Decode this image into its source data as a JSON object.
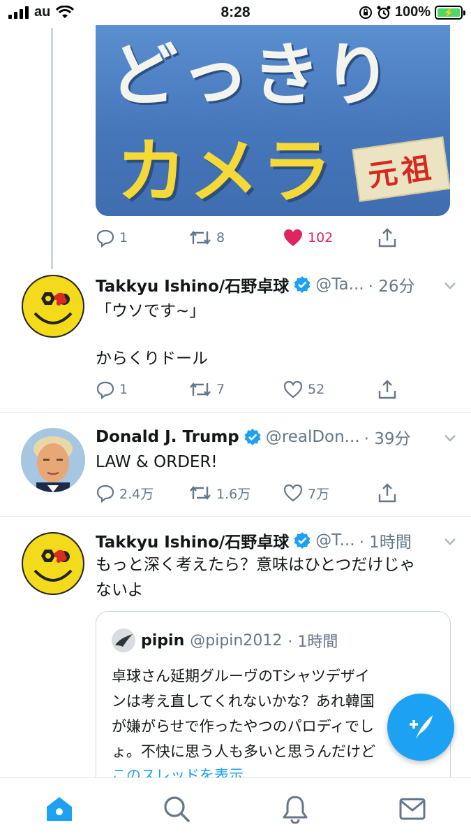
{
  "status_bar": {
    "carrier": "au",
    "time": "8:28",
    "battery": "100%"
  },
  "tweet0": {
    "media_text_top": "どっきり",
    "media_text_main": "カメラ",
    "media_text_badge": "元祖",
    "replies": "1",
    "retweets": "8",
    "likes": "102"
  },
  "tweet1": {
    "name": "Takkyu Ishino/石野卓球",
    "handle": "@Ta...",
    "time": "· 26分",
    "line1": "「ウソです~」",
    "line2": "からくりドール",
    "replies": "1",
    "retweets": "7",
    "likes": "52"
  },
  "tweet2": {
    "name": "Donald J. Trump",
    "handle": "@realDon...",
    "time": "· 39分",
    "text": "LAW & ORDER!",
    "replies": "2.4万",
    "retweets": "1.6万",
    "likes": "7万"
  },
  "tweet3": {
    "name": "Takkyu Ishino/石野卓球",
    "handle": "@T...",
    "time": "· 1時間",
    "line1": "もっと深く考えたら？意味はひとつだけじゃ",
    "line2": "ないよ",
    "quote": {
      "name": "pipin",
      "handle": "@pipin2012",
      "time": "· 1時間",
      "line1": "卓球さん延期グルーヴのTシャツデザイ",
      "line2": "ンは考え直してくれないかな？あれ韓国",
      "line3": "が嫌がらせで作ったやつのパロディでし",
      "line4": "ょ。不快に思う人も多いと思うんだけど",
      "show_thread": "このスレッドを表示"
    }
  },
  "colors": {
    "twitter_blue": "#1da1f2",
    "like_red": "#e0245e",
    "gray": "#657786",
    "battery_green": "#4cd964"
  },
  "icons": {
    "home": "home-icon",
    "search": "search-icon",
    "notifications": "bell-icon",
    "messages": "mail-icon",
    "compose": "compose-icon"
  }
}
